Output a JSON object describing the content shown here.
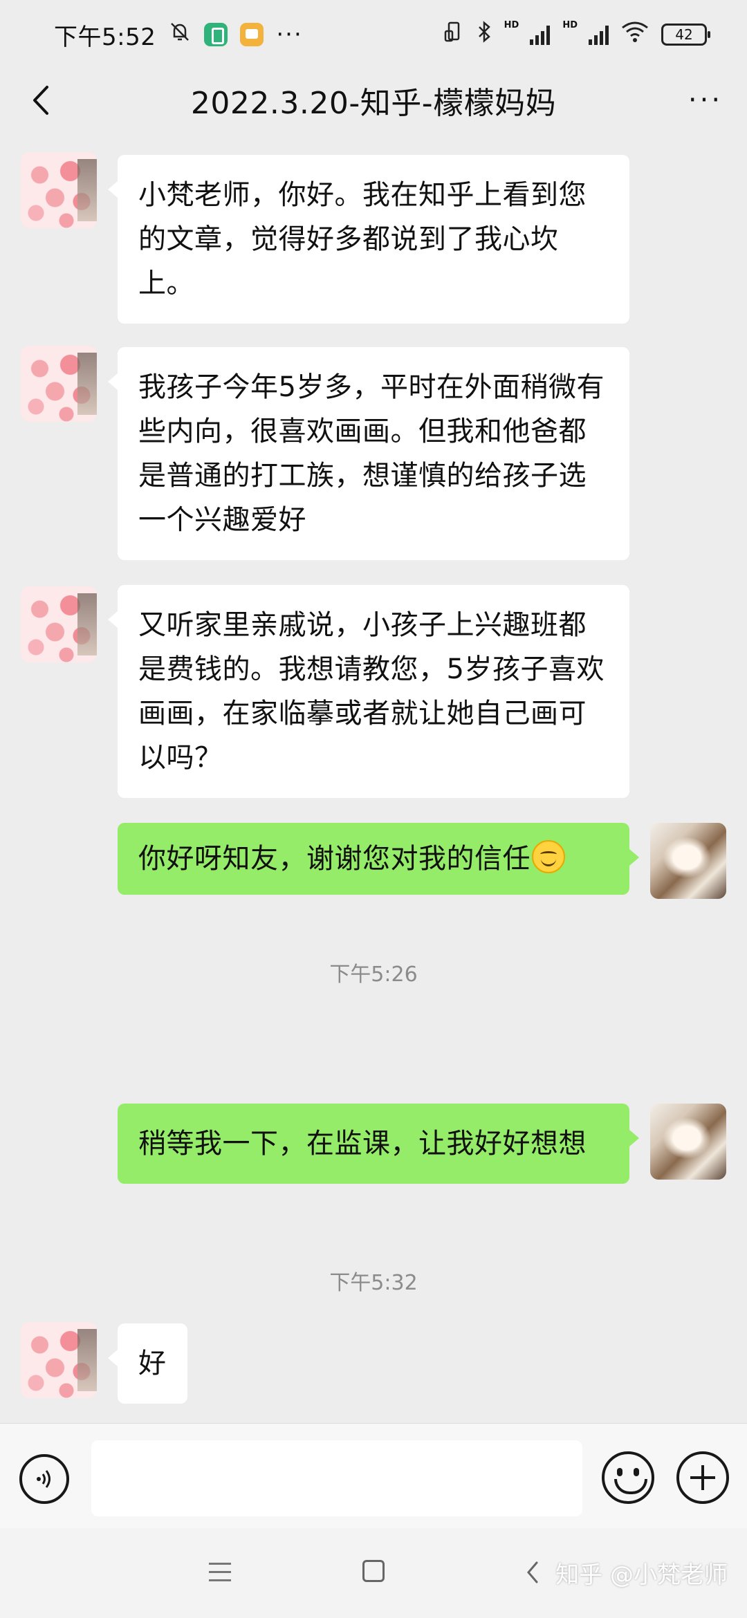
{
  "status_bar": {
    "time": "下午5:52",
    "more": "···",
    "hd1": "HD",
    "hd2": "HD",
    "battery": "42"
  },
  "header": {
    "title": "2022.3.20-知乎-檬檬妈妈",
    "more": "···"
  },
  "messages": [
    {
      "side": "left",
      "text": "小梵老师，你好。我在知乎上看到您的文章，觉得好多都说到了我心坎上。"
    },
    {
      "side": "left",
      "text": "我孩子今年5岁多，平时在外面稍微有些内向，很喜欢画画。但我和他爸都是普通的打工族，想谨慎的给孩子选一个兴趣爱好"
    },
    {
      "side": "left",
      "text": "又听家里亲戚说，小孩子上兴趣班都是费钱的。我想请教您，5岁孩子喜欢画画，在家临摹或者就让她自己画可以吗？"
    },
    {
      "side": "right",
      "text": "你好呀知友，谢谢您对我的信任"
    },
    {
      "side": "right",
      "text": "稍等我一下，在监课，让我好好想想"
    },
    {
      "side": "left",
      "text": "好"
    }
  ],
  "timestamps": [
    "下午5:26",
    "下午5:32"
  ],
  "input": {
    "value": "",
    "placeholder": ""
  },
  "watermark": "知乎 @小梵老师",
  "colors": {
    "background": "#ededed",
    "incoming_bubble": "#ffffff",
    "outgoing_bubble": "#95ec69",
    "timestamp": "#8b8b8b"
  },
  "icons": [
    "mute-bell-icon",
    "vpn-shield-icon",
    "notes-app-icon",
    "bluetooth-icon",
    "signal-icon",
    "wifi-icon",
    "battery-icon",
    "back-chevron-icon",
    "voice-input-icon",
    "emoji-icon",
    "plus-icon",
    "nav-menu-icon",
    "nav-home-icon",
    "nav-back-icon"
  ]
}
